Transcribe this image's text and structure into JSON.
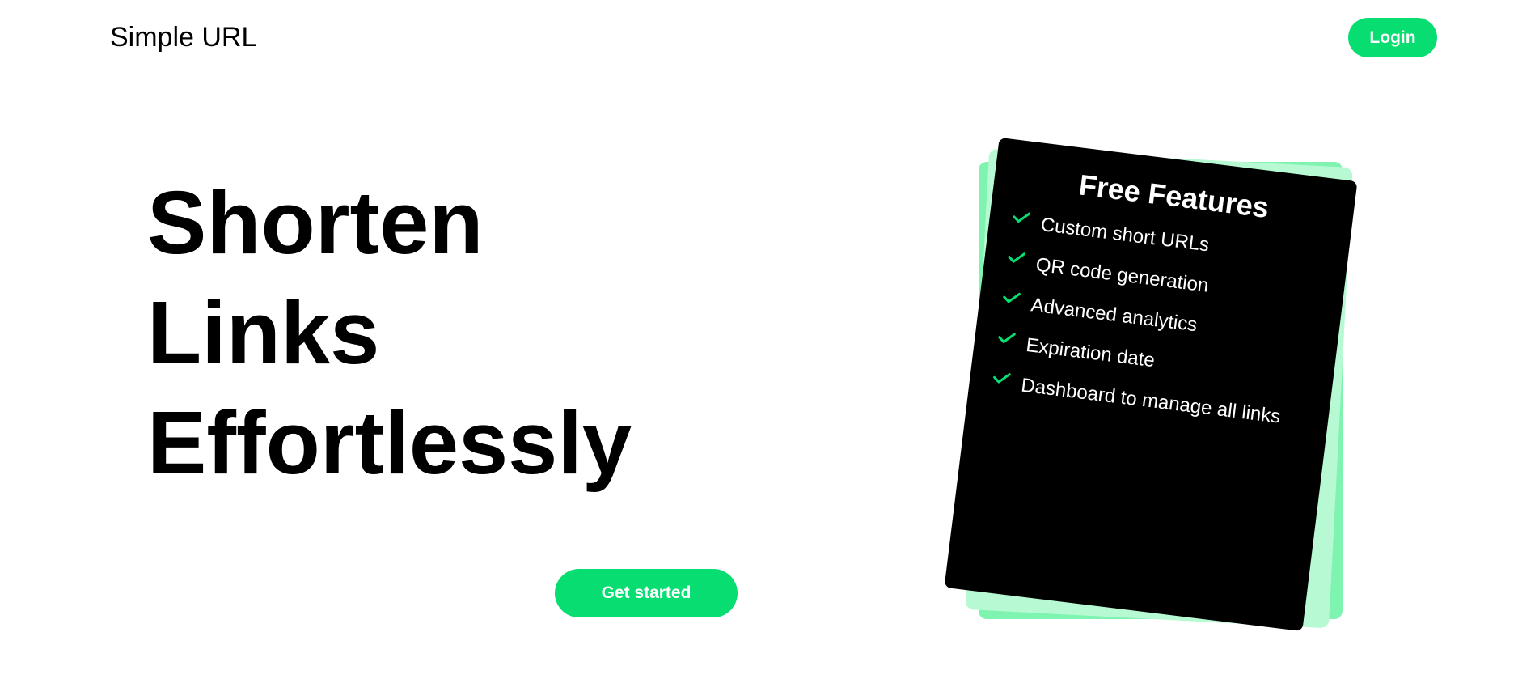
{
  "header": {
    "brand": "Simple URL",
    "login_label": "Login"
  },
  "hero": {
    "title_lines": [
      "Shorten",
      "Links",
      "Effortlessly"
    ],
    "cta_label": "Get started"
  },
  "features_card": {
    "title": "Free Features",
    "items": [
      {
        "label": "Custom short URLs",
        "icon": "check-icon"
      },
      {
        "label": "QR code generation",
        "icon": "check-icon"
      },
      {
        "label": "Advanced analytics",
        "icon": "check-icon"
      },
      {
        "label": "Expiration date",
        "icon": "check-icon"
      },
      {
        "label": "Dashboard to manage all links",
        "icon": "check-icon"
      }
    ]
  },
  "colors": {
    "accent": "#07dd71",
    "card_background": "#000000",
    "stack_back": "#7ff3b0",
    "stack_mid": "#b7f9d3"
  }
}
